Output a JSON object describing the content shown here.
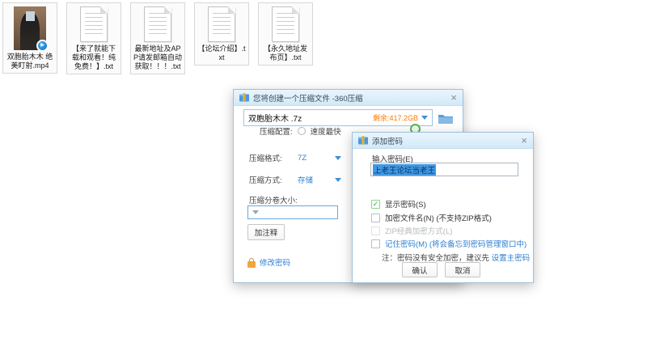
{
  "glyphs": {
    "close": "×",
    "check": "✓",
    "play": "▶"
  },
  "colors": {
    "accent_blue": "#2f7fd0",
    "warning_orange": "#ff7a00",
    "success_green": "#57b257",
    "selection_blue": "#4098e2",
    "titlebar_blue": "#d2e9f8"
  },
  "desktop": {
    "files": [
      {
        "kind": "video",
        "name": "双胞胎木木  绝美盯射.mp4"
      },
      {
        "kind": "text",
        "name": "【来了就能下载和观看！纯免费！】.txt"
      },
      {
        "kind": "text",
        "name": "最新地址及APP请发邮箱自动获取！！！.txt"
      },
      {
        "kind": "text",
        "name": "【论坛介绍】.txt"
      },
      {
        "kind": "text",
        "name": "【永久地址发布页】.txt"
      }
    ]
  },
  "compress_dialog": {
    "title": "您将创建一个压缩文件 -360压缩",
    "filename": "双胞胎木木 .7z",
    "space_remaining": "剩余:417.2GB",
    "config_label": "压缩配置:",
    "config_option_fastest": "速度最快",
    "format_label": "压缩格式:",
    "format_value": "7Z",
    "method_label": "压缩方式:",
    "method_value": "存储",
    "split_label": "压缩分卷大小:",
    "split_value": "",
    "comment_button": "加注释",
    "change_password_link": "修改密码"
  },
  "password_dialog": {
    "title": "添加密码",
    "password_label": "输入密码(E)",
    "password_value": "上老王论坛当老王",
    "checkboxes": [
      {
        "label": "显示密码(S)",
        "checked": true
      },
      {
        "label": "加密文件名(N) (不支持ZIP格式)",
        "checked": false
      },
      {
        "label": "ZIP经典加密方式(L)",
        "checked": false,
        "disabled": true
      },
      {
        "label": "记住密码(M) (将会备忘到密码管理窗口中)",
        "checked": false
      }
    ],
    "note_prefix": "注：密码没有安全加密，建议先 ",
    "note_link": "设置主密码",
    "confirm_button": "确认",
    "cancel_button": "取消"
  }
}
